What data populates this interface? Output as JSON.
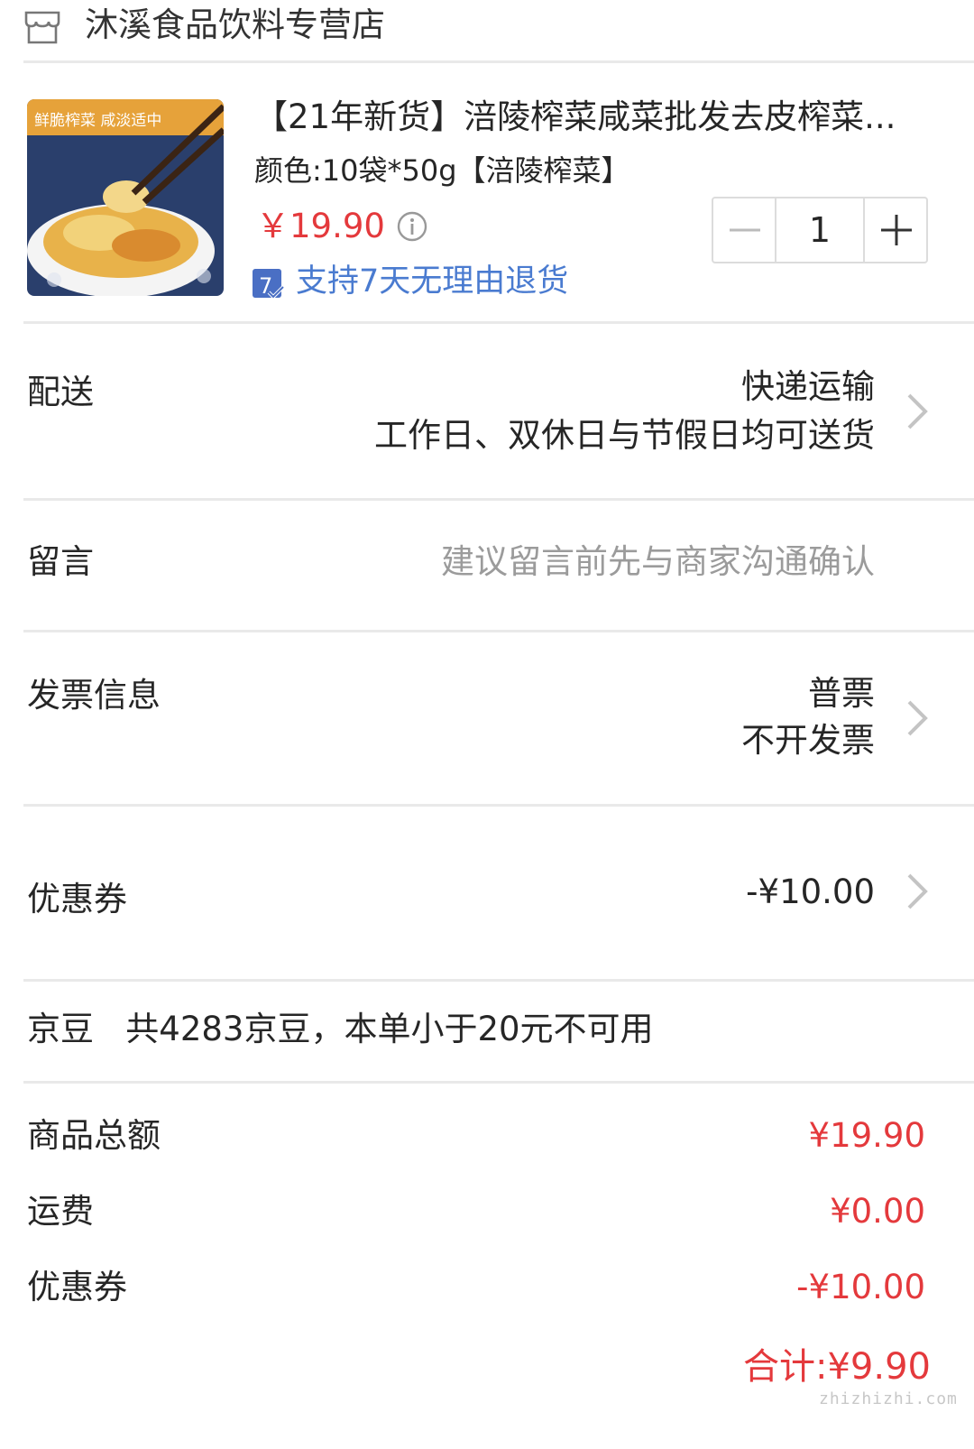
{
  "store": {
    "name": "沐溪食品饮料专营店",
    "icon": "store-icon"
  },
  "product": {
    "title": "【21年新货】涪陵榨菜咸菜批发去皮榨菜...",
    "spec": "颜色:10袋*50g【涪陵榨菜】",
    "price": "￥19.90",
    "image_caption": "鲜脆榨菜 咸淡适中",
    "return_policy": "支持7天无理由退货",
    "return_badge_number": "7",
    "quantity": "1"
  },
  "delivery": {
    "label": "配送",
    "method": "快递运输",
    "schedule": "工作日、双休日与节假日均可送货"
  },
  "message": {
    "label": "留言",
    "placeholder": "建议留言前先与商家沟通确认"
  },
  "invoice": {
    "label": "发票信息",
    "type": "普票",
    "status": "不开发票"
  },
  "coupon": {
    "label": "优惠券",
    "value": "-¥10.00"
  },
  "jingdou": {
    "label": "京豆",
    "text": "共4283京豆，本单小于20元不可用"
  },
  "summary": {
    "items": [
      {
        "label": "商品总额",
        "value": "¥19.90"
      },
      {
        "label": "运费",
        "value": "¥0.00"
      },
      {
        "label": "优惠券",
        "value": "-¥10.00"
      }
    ],
    "total_label": "合计:",
    "total_value": "¥9.90"
  },
  "watermark": "zhizhizhi.com",
  "colors": {
    "price_red": "#e4393c",
    "link_blue": "#4a7bd0",
    "divider": "#e9e9e9"
  }
}
